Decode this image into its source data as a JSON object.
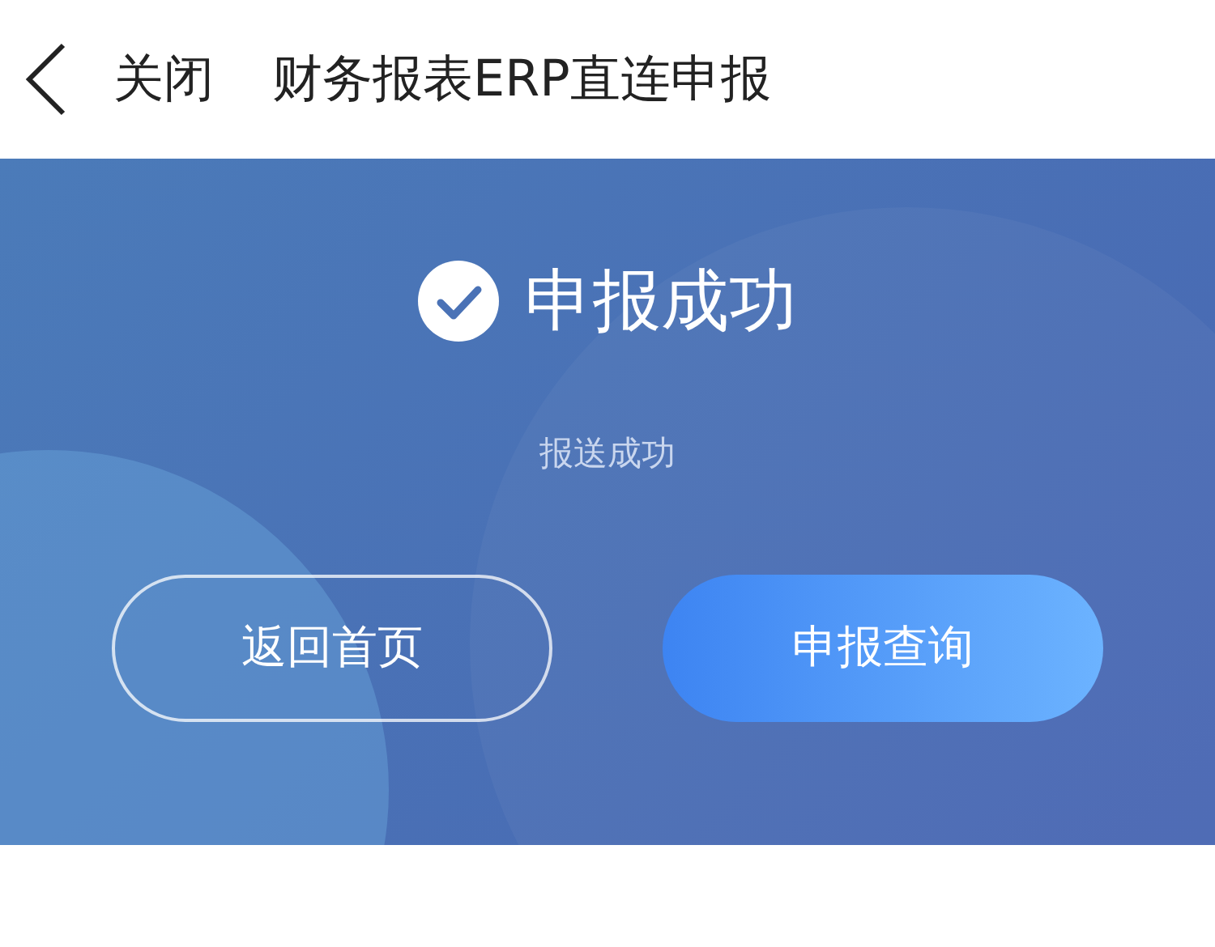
{
  "header": {
    "close": "关闭",
    "title": "财务报表ERP直连申报"
  },
  "result": {
    "title": "申报成功",
    "message": "报送成功"
  },
  "buttons": [
    {
      "label": "返回首页",
      "kind": "outline"
    },
    {
      "label": "申报查询",
      "kind": "primary"
    }
  ]
}
